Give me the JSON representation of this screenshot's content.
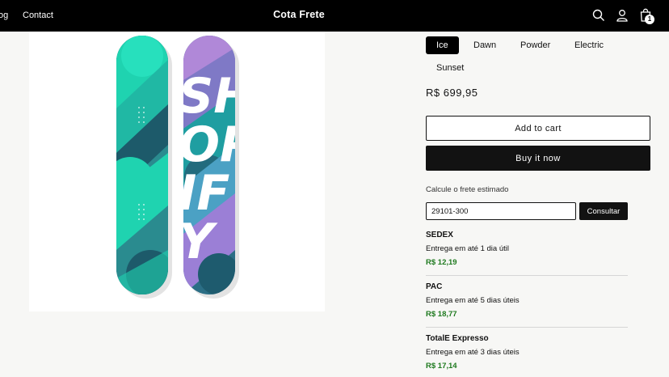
{
  "header": {
    "nav": [
      "og",
      "Contact"
    ],
    "brand": "Cota Frete",
    "cart_count": "1"
  },
  "product": {
    "variants": [
      "Ice",
      "Dawn",
      "Powder",
      "Electric",
      "Sunset"
    ],
    "selected_variant": "Ice",
    "price": "R$ 699,95",
    "add_to_cart_label": "Add to cart",
    "buy_now_label": "Buy it now",
    "board_letters": [
      "SH",
      "OP",
      "IF",
      "Y"
    ]
  },
  "shipping": {
    "title": "Calcule o frete estimado",
    "cep_value": "29101-300",
    "consult_label": "Consultar",
    "options": [
      {
        "name": "SEDEX",
        "eta": "Entrega em até 1 dia útil",
        "price": "R$ 12,19"
      },
      {
        "name": "PAC",
        "eta": "Entrega em até 5 dias úteis",
        "price": "R$ 18,77"
      },
      {
        "name": "TotalE Expresso",
        "eta": "Entrega em até 3 dias úteis",
        "price": "R$ 17,14"
      }
    ]
  },
  "colors": {
    "header_bg": "#000000",
    "price_green": "#1f7a1f",
    "board_teal": "#1fd3b0",
    "board_dark": "#1d5a6a",
    "board_purple": "#b088d8"
  },
  "icons": [
    "search-icon",
    "account-icon",
    "cart-icon"
  ]
}
